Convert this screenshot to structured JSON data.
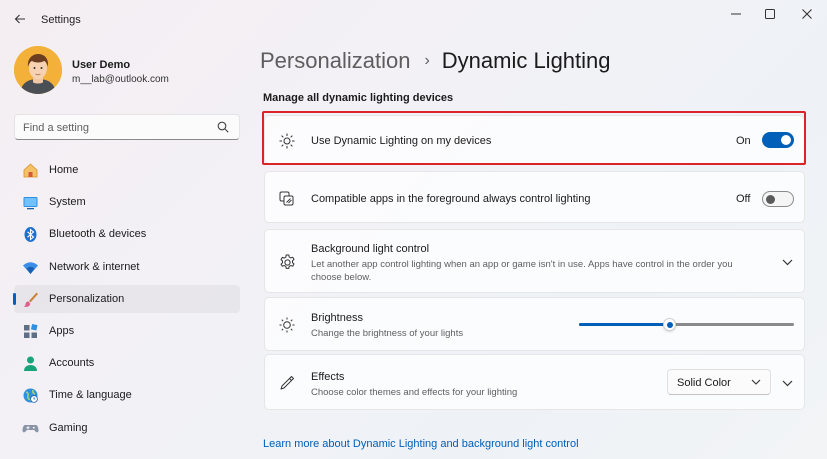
{
  "window": {
    "title": "Settings",
    "controls": [
      "minimize",
      "maximize",
      "close"
    ]
  },
  "user": {
    "name": "User Demo",
    "email": "m__lab@outlook.com"
  },
  "search": {
    "placeholder": "Find a setting",
    "value": ""
  },
  "sidebar": {
    "items": [
      {
        "label": "Home",
        "icon": "home-icon"
      },
      {
        "label": "System",
        "icon": "system-icon"
      },
      {
        "label": "Bluetooth & devices",
        "icon": "bluetooth-icon"
      },
      {
        "label": "Network & internet",
        "icon": "wifi-icon"
      },
      {
        "label": "Personalization",
        "icon": "brush-icon",
        "selected": true
      },
      {
        "label": "Apps",
        "icon": "apps-icon"
      },
      {
        "label": "Accounts",
        "icon": "accounts-icon"
      },
      {
        "label": "Time & language",
        "icon": "globe-icon"
      },
      {
        "label": "Gaming",
        "icon": "gamepad-icon"
      }
    ]
  },
  "breadcrumb": {
    "parent": "Personalization",
    "separator": "›",
    "current": "Dynamic Lighting"
  },
  "main": {
    "section_title": "Manage all dynamic lighting devices",
    "settings": {
      "use_dynamic": {
        "title": "Use Dynamic Lighting on my devices",
        "state_label": "On",
        "on": true
      },
      "compatible_apps": {
        "title": "Compatible apps in the foreground always control lighting",
        "state_label": "Off",
        "on": false
      },
      "background": {
        "title": "Background light control",
        "desc_line1": "Let another app control lighting when an app or game isn't in use. Apps have control in the order you",
        "desc_line2": "choose below."
      },
      "brightness": {
        "title": "Brightness",
        "desc": "Change the brightness of your lights",
        "value_fraction": 0.42
      },
      "effects": {
        "title": "Effects",
        "desc": "Choose color themes and effects for your lighting",
        "selected": "Solid Color"
      }
    },
    "learn_more": "Learn more about Dynamic Lighting and background light control"
  },
  "colors": {
    "accent": "#005fb8",
    "highlight_border": "#d9252a"
  }
}
